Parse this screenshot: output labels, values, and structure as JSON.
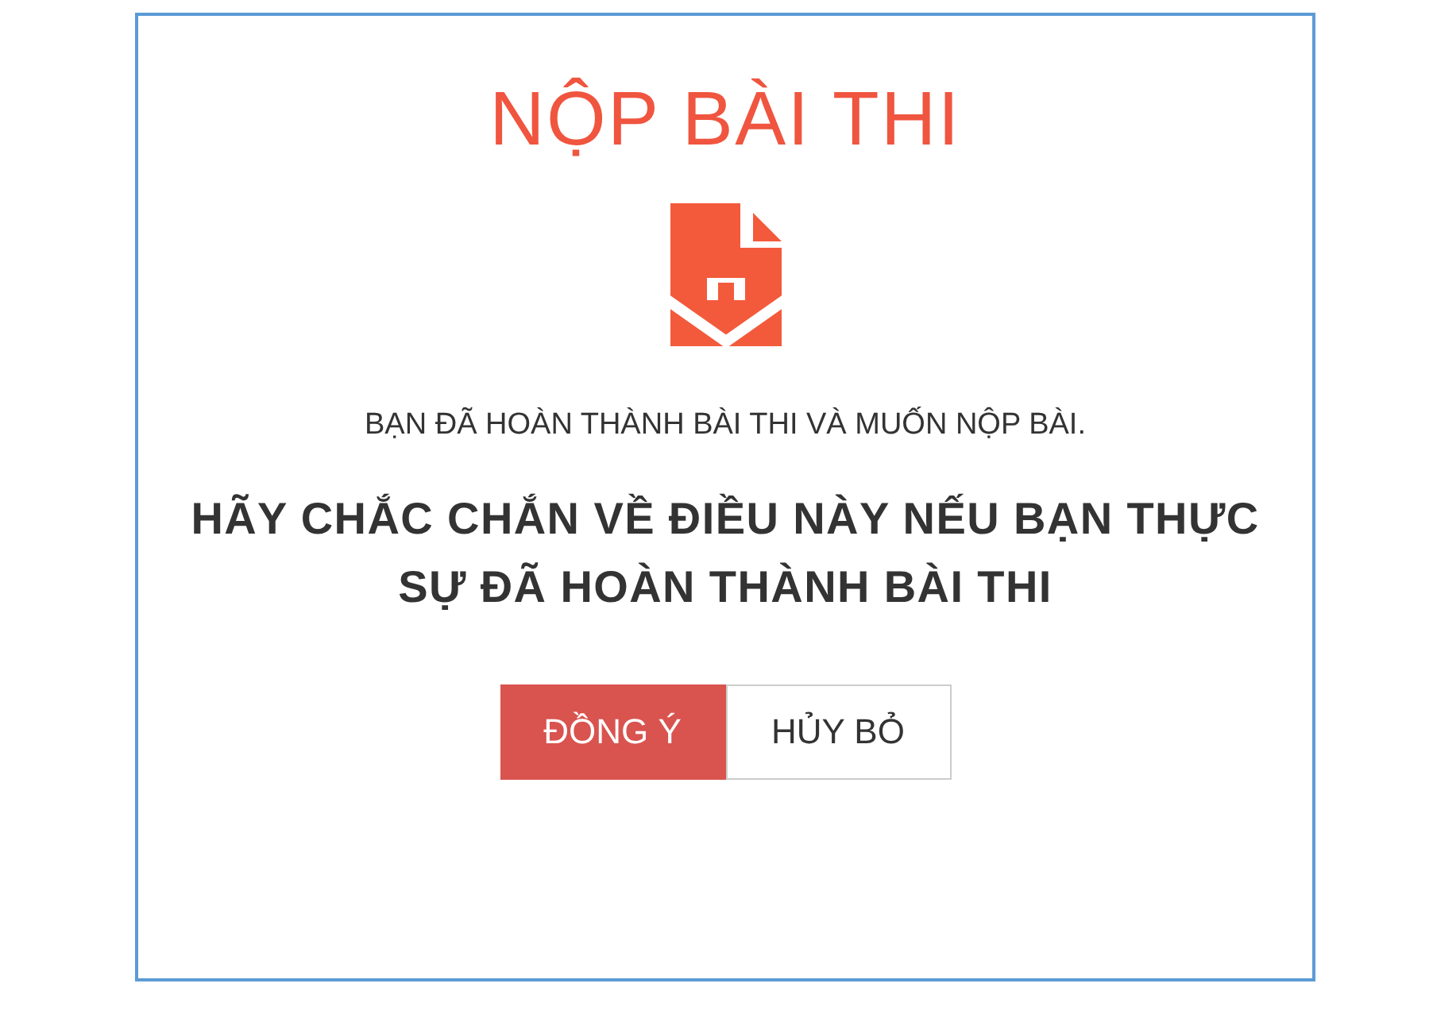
{
  "dialog": {
    "title": "NỘP BÀI THI",
    "message": "BẠN ĐÃ HOÀN THÀNH BÀI THI VÀ MUỐN NỘP BÀI.",
    "warning": [
      "HÃY CHẮC CHẮN VỀ ĐIỀU NÀY NẾU BẠN THỰC",
      "SỰ ĐÃ HOÀN THÀNH BÀI THI"
    ],
    "buttons": [
      {
        "label": "ĐỒNG Ý",
        "kind": "primary"
      },
      {
        "label": "HỦY BỎ",
        "kind": "default"
      }
    ]
  }
}
